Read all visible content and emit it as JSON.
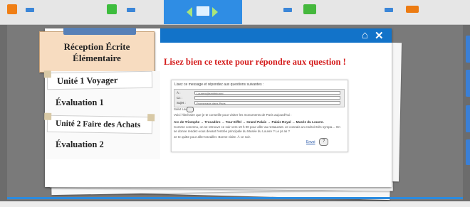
{
  "colors": {
    "accent": "#2f8de4",
    "title_red": "#d41c1c",
    "tab_fill": "#f7dcc0"
  },
  "toolbar": {
    "icons": [
      "orange-card-icon",
      "green-card-icon",
      "blue-nav-icon",
      "blue-card-icon",
      "orange-card-icon"
    ]
  },
  "lesson": {
    "title_line1": "Réception Écrite",
    "title_line2": "Élémentaire",
    "tabs": [
      {
        "label": "Unité 1 Voyager"
      },
      {
        "label": "Évaluation 1"
      },
      {
        "label": "Unité 2 Faire des Achats"
      },
      {
        "label": "Évaluation 2"
      }
    ]
  },
  "content": {
    "heading": "Lisez bien ce texte pour répondre aux question !",
    "instructions": "Lisez ce message et répondez aux questions suivantes :",
    "email": {
      "from_label": "À :",
      "from_value": "Laurent@smithboard",
      "cc_label": "Cc :",
      "cc_value": "",
      "subject_label": "Sujet :",
      "subject_value": "Promenade dans Paris",
      "salutation": "Salut Laurent,",
      "para1": "Voici l'itinéraire que je te conseille pour visiter les monuments de Paris aujourd'hui :",
      "route": "Arc de Triomphe → Trocadéro → Tour Eiffel → Grand Palais → Palais Royal → Musée du Louvre.",
      "para2": "Comme convenu, on se retrouve ce soir vers 19 h 00 pour aller au restaurant. Je connais un endroit très sympa… On se donne rendez-vous devant l'entrée principale du Musée du Louvre ? Le pr as ?",
      "para3": "Je te quitte pour aller travailler. Bonne visite. À ce soir.",
      "send": "Envoi"
    }
  }
}
